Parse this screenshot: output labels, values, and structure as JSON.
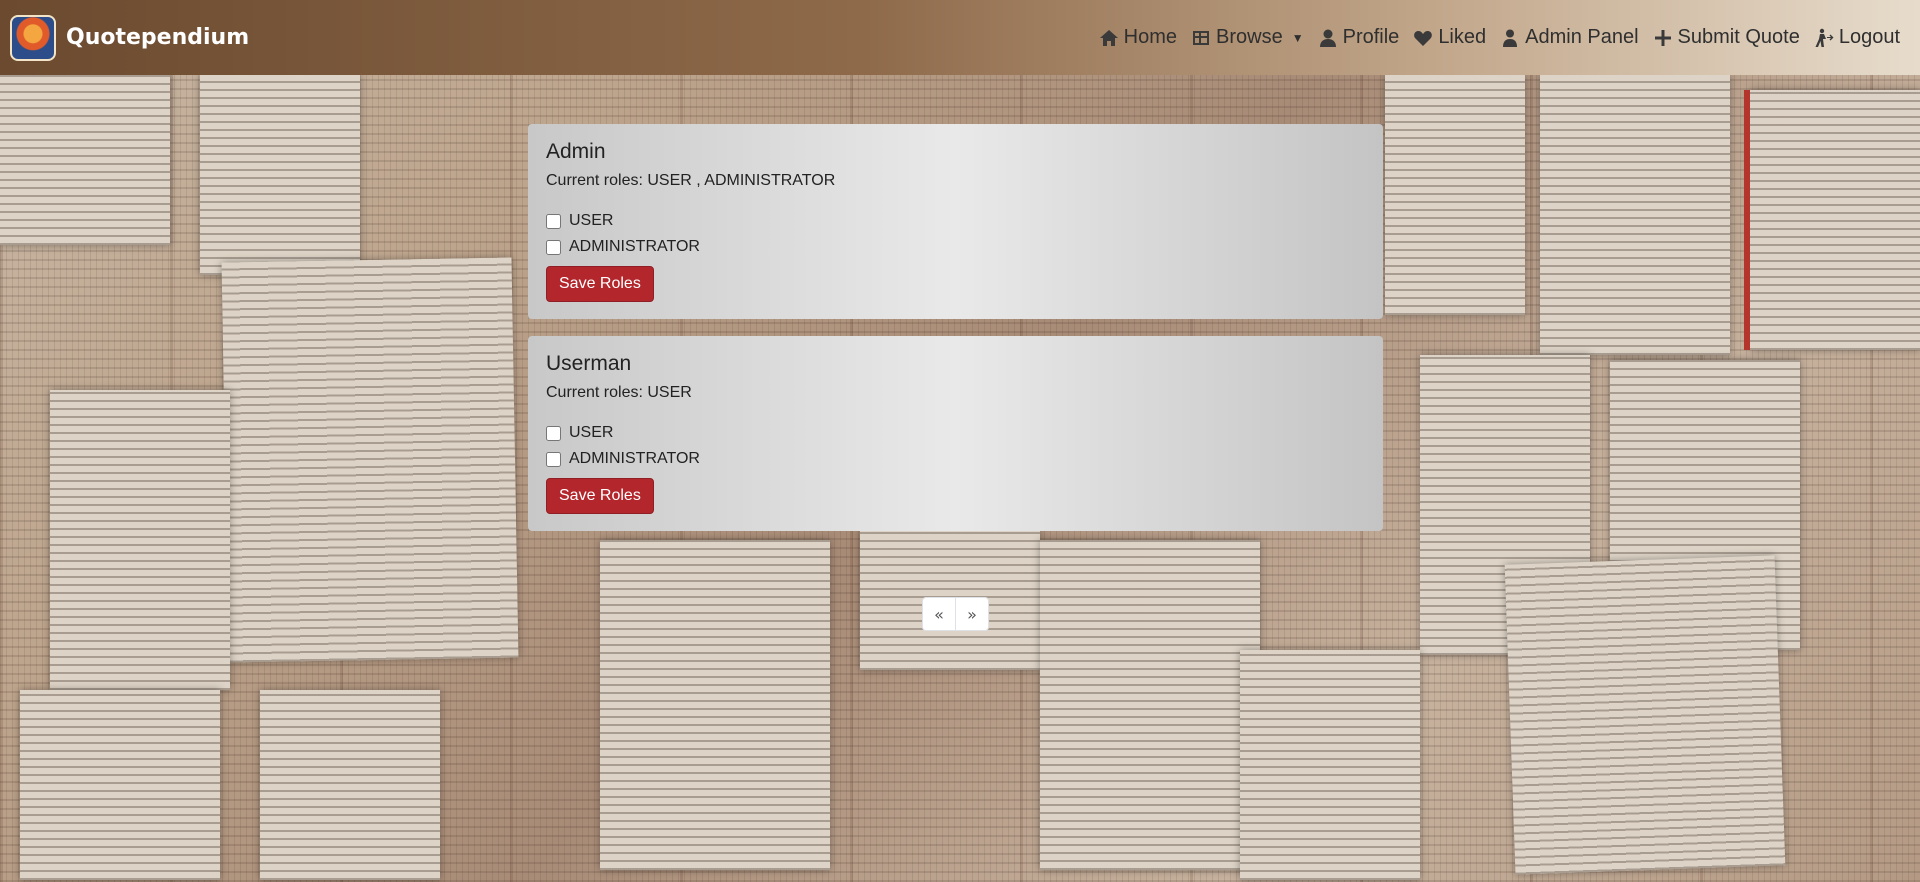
{
  "brand": {
    "name": "Quotependium"
  },
  "nav": {
    "home": "Home",
    "browse": "Browse",
    "profile": "Profile",
    "liked": "Liked",
    "admin_panel": "Admin Panel",
    "submit_quote": "Submit Quote",
    "logout": "Logout"
  },
  "users": [
    {
      "name": "Admin",
      "current_roles": "Current roles: USER , ADMINISTRATOR",
      "role_options": [
        "USER",
        "ADMINISTRATOR"
      ],
      "save_label": "Save Roles"
    },
    {
      "name": "Userman",
      "current_roles": "Current roles: USER",
      "role_options": [
        "USER",
        "ADMINISTRATOR"
      ],
      "save_label": "Save Roles"
    }
  ],
  "pagination": {
    "prev": "«",
    "next": "»"
  },
  "colors": {
    "save_button": "#b3262c",
    "nav_gradient_start": "#6b4a2f",
    "nav_gradient_end": "#e7dccc"
  }
}
